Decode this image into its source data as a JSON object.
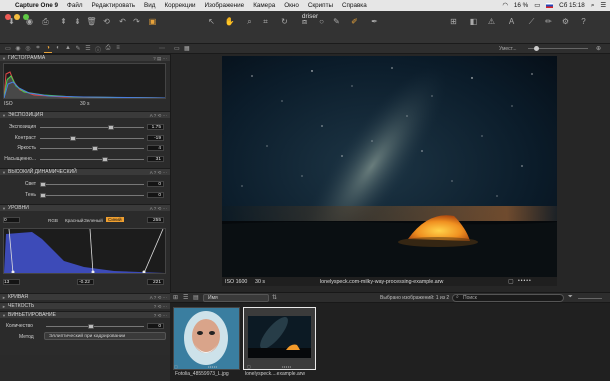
{
  "menubar": {
    "app": "Capture One 9",
    "items": [
      "Файл",
      "Редактировать",
      "Вид",
      "Коррекции",
      "Изображение",
      "Камера",
      "Окно",
      "Скрипты",
      "Справка"
    ],
    "battery": "16 %",
    "clock": "Сб 15:18"
  },
  "window": {
    "title": "driser"
  },
  "viewer_top": {
    "zoom_label": "Умест..."
  },
  "tools": {
    "histogram": {
      "title": "ГИСТОГРАММА",
      "iso": "ISO",
      "shutter": "30 s"
    },
    "exposure": {
      "title": "ЭКСПОЗИЦИЯ",
      "rows": [
        {
          "label": "Экспозиция",
          "value": "1.75"
        },
        {
          "label": "Контраст",
          "value": "-19"
        },
        {
          "label": "Яркость",
          "value": "4"
        },
        {
          "label": "Насыщенно...",
          "value": "31"
        }
      ]
    },
    "hdr": {
      "title": "ВЫСОКИЙ ДИНАМИЧЕСКИЙ",
      "rows": [
        {
          "label": "Свет",
          "value": "0"
        },
        {
          "label": "Тень",
          "value": "0"
        }
      ]
    },
    "levels": {
      "title": "УРОВНИ",
      "in_low": "0",
      "in_high": "255",
      "tabs": [
        "RGB",
        "Красный",
        "Зеленый",
        "Синий"
      ],
      "active_tab": "Синий",
      "out_low": "13",
      "mid": "-0.22",
      "out_high": "221"
    },
    "curve": {
      "title": "КРИВАЯ"
    },
    "clarity": {
      "title": "ЧЕТКОСТЬ"
    },
    "vignette": {
      "title": "ВИНЬЕТИРОВАНИЕ",
      "amount_label": "Количество",
      "amount_value": "0",
      "method_label": "Метод",
      "method_value": "Эллиптический при кадрировании"
    }
  },
  "viewer": {
    "iso": "ISO 1600",
    "shutter": "30 s",
    "filename": "lonelyspeck.com-milky-way-processing-example.arw"
  },
  "browser": {
    "sort": "Имя",
    "selected": "Выбрано изображений: 1 из 2",
    "search_placeholder": "Поиск",
    "thumbs": [
      {
        "name": "Fotolia_48559973_L.jpg"
      },
      {
        "name": "lonelyspeck....example.arw"
      }
    ]
  },
  "colors": {
    "accent": "#e8a33a",
    "active_tab": "#f0a030"
  }
}
